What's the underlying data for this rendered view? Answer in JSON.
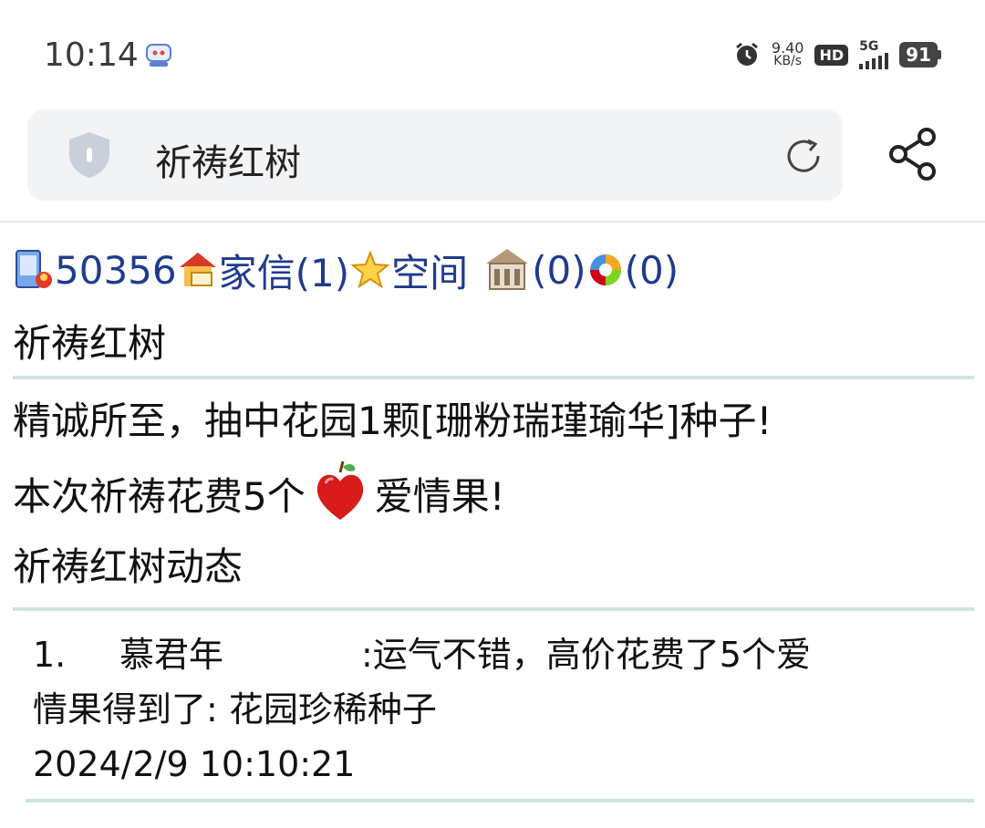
{
  "status": {
    "time": "10:14",
    "net_speed_value": "9.40",
    "net_speed_unit": "KB/s",
    "hd_label": "HD",
    "network_label": "5G",
    "battery": "91"
  },
  "search": {
    "query": "祈祷红树"
  },
  "nav": {
    "user_id": "50356",
    "letters_label": "家信(1)",
    "space_label": "空间",
    "house_count": "(0)",
    "album_count": "(0)"
  },
  "page": {
    "title": "祈祷红树",
    "result_line": "精诚所至，抽中花园1颗[珊粉瑞瑾瑜华]种子!",
    "cost_prefix": "本次祈祷花费5个",
    "cost_suffix": "爱情果!",
    "feed_heading": "祈祷红树动态"
  },
  "feed": [
    {
      "index": "1.",
      "user": "慕君年",
      "text_line1": ":运气不错，高价花费了5个爱",
      "text_line2": "情果得到了: 花园珍稀种子",
      "timestamp": "2024/2/9 10:10:21"
    }
  ]
}
